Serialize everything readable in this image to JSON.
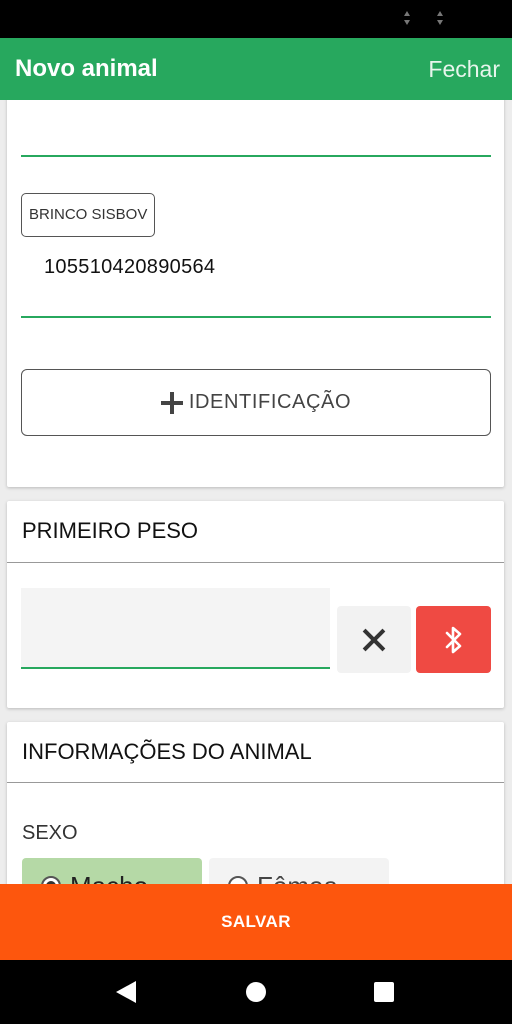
{
  "app_bar": {
    "title": "Novo animal",
    "close_label": "Fechar",
    "color": "#27a85e"
  },
  "identification": {
    "chip_label": "BRINCO SISBOV",
    "value": "105510420890564",
    "add_button_label": "IDENTIFICAÇÃO",
    "add_icon": "plus-icon"
  },
  "first_weight": {
    "title": "PRIMEIRO PESO",
    "input_value": "",
    "clear_icon": "close-icon",
    "bluetooth_icon": "bluetooth-icon",
    "bluetooth_color": "#ef4a43"
  },
  "animal_info": {
    "title": "INFORMAÇÕES DO ANIMAL",
    "sex_label": "SEXO",
    "sex_options": [
      {
        "label": "Macho",
        "selected": true
      },
      {
        "label": "Fêmea",
        "selected": false
      }
    ]
  },
  "footer": {
    "save_label": "SALVAR",
    "color": "#fd560d"
  },
  "system_nav": {
    "icons": [
      "back-icon",
      "home-icon",
      "recents-icon"
    ]
  }
}
